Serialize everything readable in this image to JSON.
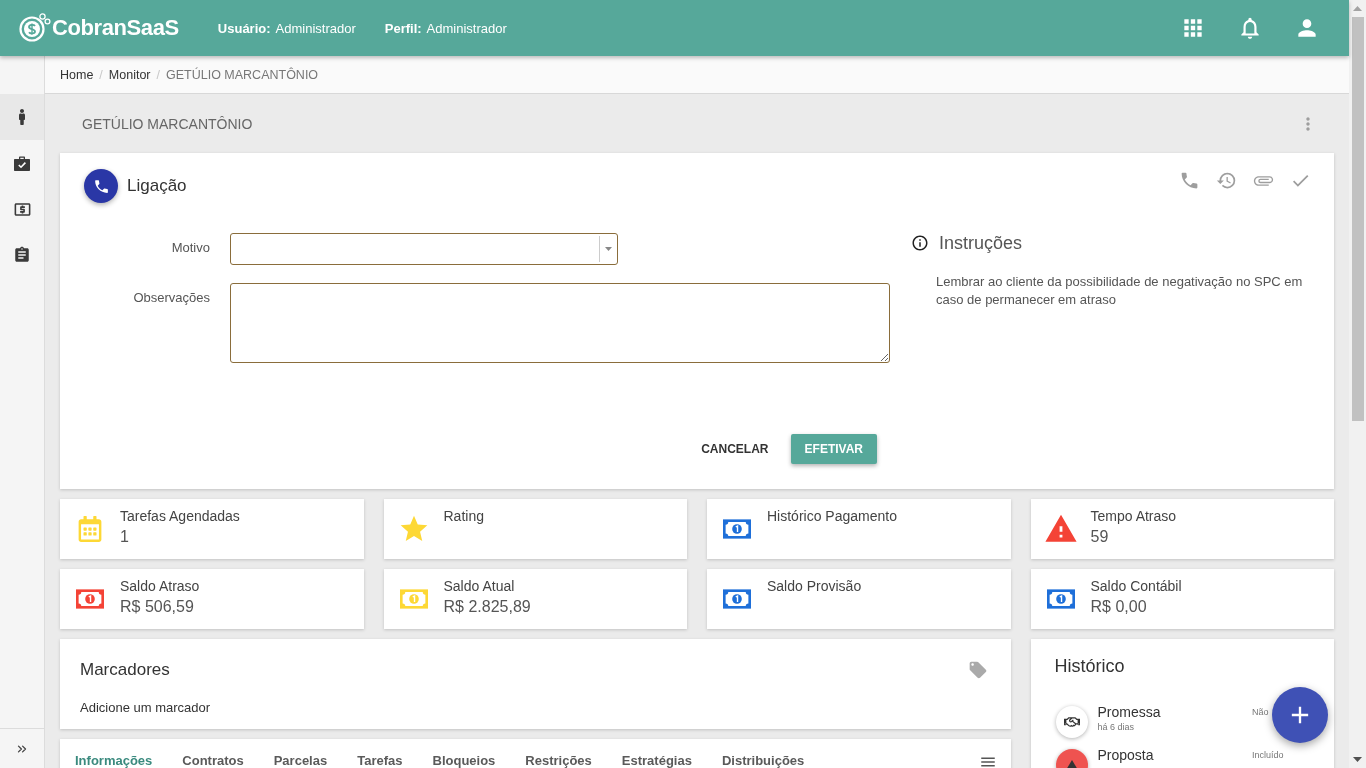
{
  "header": {
    "logo": "CobranSaaS",
    "user": {
      "label": "Usuário:",
      "value": "Administrador"
    },
    "profile": {
      "label": "Perfil:",
      "value": "Administrador"
    }
  },
  "sidebar": {
    "items": [
      {
        "selected": true
      },
      {
        "selected": false
      },
      {
        "selected": false
      },
      {
        "selected": false
      }
    ]
  },
  "breadcrumb": {
    "separator": "/",
    "items": [
      "Home",
      "Monitor",
      "GETÚLIO MARCANTÔNIO"
    ]
  },
  "page_title": "GETÚLIO MARCANTÔNIO",
  "call_card": {
    "title": "Ligação",
    "fields": [
      {
        "kind": "select",
        "label": "Motivo"
      },
      {
        "kind": "textarea",
        "label": "Observações"
      }
    ],
    "instructions": {
      "title": "Instruções",
      "text": "Lembrar ao cliente da possibilidade de negativação no SPC em caso de permanecer em atraso"
    },
    "buttons": [
      {
        "kind": "flat",
        "label": "CANCELAR"
      },
      {
        "kind": "raised",
        "label": "EFETIVAR"
      }
    ]
  },
  "stats": [
    {
      "label": "Tarefas Agendadas",
      "value": "1",
      "color": "#fdd835"
    },
    {
      "label": "Rating",
      "color": "#fdd835"
    },
    {
      "label": "Histórico Pagamento",
      "color": "#1e6fd9"
    },
    {
      "label": "Tempo Atraso",
      "value": "59",
      "color": "#f44336"
    },
    {
      "label": "Saldo Atraso",
      "value": "R$ 506,59",
      "color": "#f44336"
    },
    {
      "label": "Saldo Atual",
      "value": "R$ 2.825,89",
      "color": "#fdd835"
    },
    {
      "label": "Saldo Provisão",
      "color": "#1e6fd9"
    },
    {
      "label": "Saldo Contábil",
      "value": "R$ 0,00",
      "color": "#1e6fd9"
    }
  ],
  "markers": {
    "title": "Marcadores",
    "prompt": "Adicione um marcador"
  },
  "tabs": [
    {
      "label": "Informações",
      "selected": true
    },
    {
      "label": "Contratos",
      "selected": false
    },
    {
      "label": "Parcelas",
      "selected": false
    },
    {
      "label": "Tarefas",
      "selected": false
    },
    {
      "label": "Bloqueios",
      "selected": false
    },
    {
      "label": "Restrições",
      "selected": false
    },
    {
      "label": "Estratégias",
      "selected": false
    },
    {
      "label": "Distribuições",
      "selected": false
    }
  ],
  "history": {
    "title": "Histórico",
    "items": [
      {
        "title": "Promessa",
        "time": "há 6 dias",
        "status": "Não",
        "color": "#ffffff"
      },
      {
        "title": "Proposta",
        "status": "Incluído",
        "color": "#ef5350"
      }
    ]
  }
}
